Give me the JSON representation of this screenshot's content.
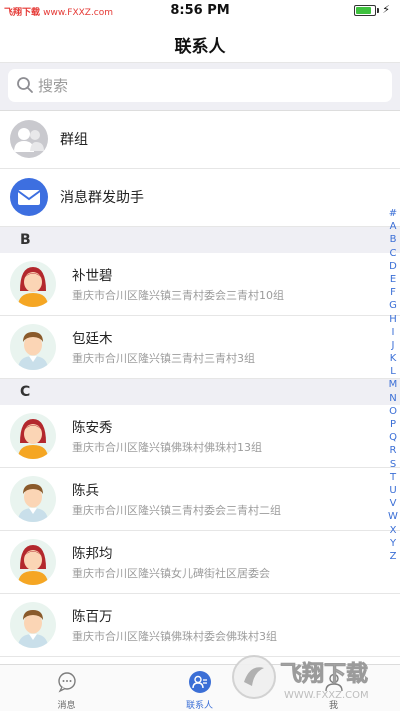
{
  "status_bar": {
    "watermark_left": "飞翔下载",
    "watermark_url": "www.FXXZ.com",
    "time": "8:56 PM"
  },
  "header": {
    "title": "联系人"
  },
  "search": {
    "placeholder": "搜索"
  },
  "top_items": [
    {
      "label": "群组",
      "icon": "group-icon"
    },
    {
      "label": "消息群发助手",
      "icon": "mail-icon"
    }
  ],
  "sections": [
    {
      "letter": "B",
      "contacts": [
        {
          "name": "补世碧",
          "address": "重庆市合川区隆兴镇三青村委会三青村10组",
          "avatar": "female"
        },
        {
          "name": "包廷木",
          "address": "重庆市合川区隆兴镇三青村三青村3组",
          "avatar": "male"
        }
      ]
    },
    {
      "letter": "C",
      "contacts": [
        {
          "name": "陈安秀",
          "address": "重庆市合川区隆兴镇佛珠村佛珠村13组",
          "avatar": "female"
        },
        {
          "name": "陈兵",
          "address": "重庆市合川区隆兴镇三青村委会三青村二组",
          "avatar": "male"
        },
        {
          "name": "陈邦均",
          "address": "重庆市合川区隆兴镇女儿碑街社区居委会",
          "avatar": "female"
        },
        {
          "name": "陈百万",
          "address": "重庆市合川区隆兴镇佛珠村委会佛珠村3组",
          "avatar": "male"
        }
      ]
    }
  ],
  "index_letters": [
    "#",
    "A",
    "B",
    "C",
    "D",
    "E",
    "F",
    "G",
    "H",
    "I",
    "J",
    "K",
    "L",
    "M",
    "N",
    "O",
    "P",
    "Q",
    "R",
    "S",
    "T",
    "U",
    "V",
    "W",
    "X",
    "Y",
    "Z"
  ],
  "tabs": [
    {
      "label": "消息",
      "icon": "chat-bubble-icon",
      "active": false
    },
    {
      "label": "联系人",
      "icon": "contacts-icon",
      "active": true
    },
    {
      "label": "我",
      "icon": "profile-icon",
      "active": false
    }
  ],
  "watermark_badge": {
    "cn": "飞翔下载",
    "url": "WWW.FXXZ.COM"
  },
  "colors": {
    "accent": "#3b6fd6",
    "section_bg": "#efeff4",
    "battery": "#3ec13e",
    "watermark": "#e53935"
  }
}
